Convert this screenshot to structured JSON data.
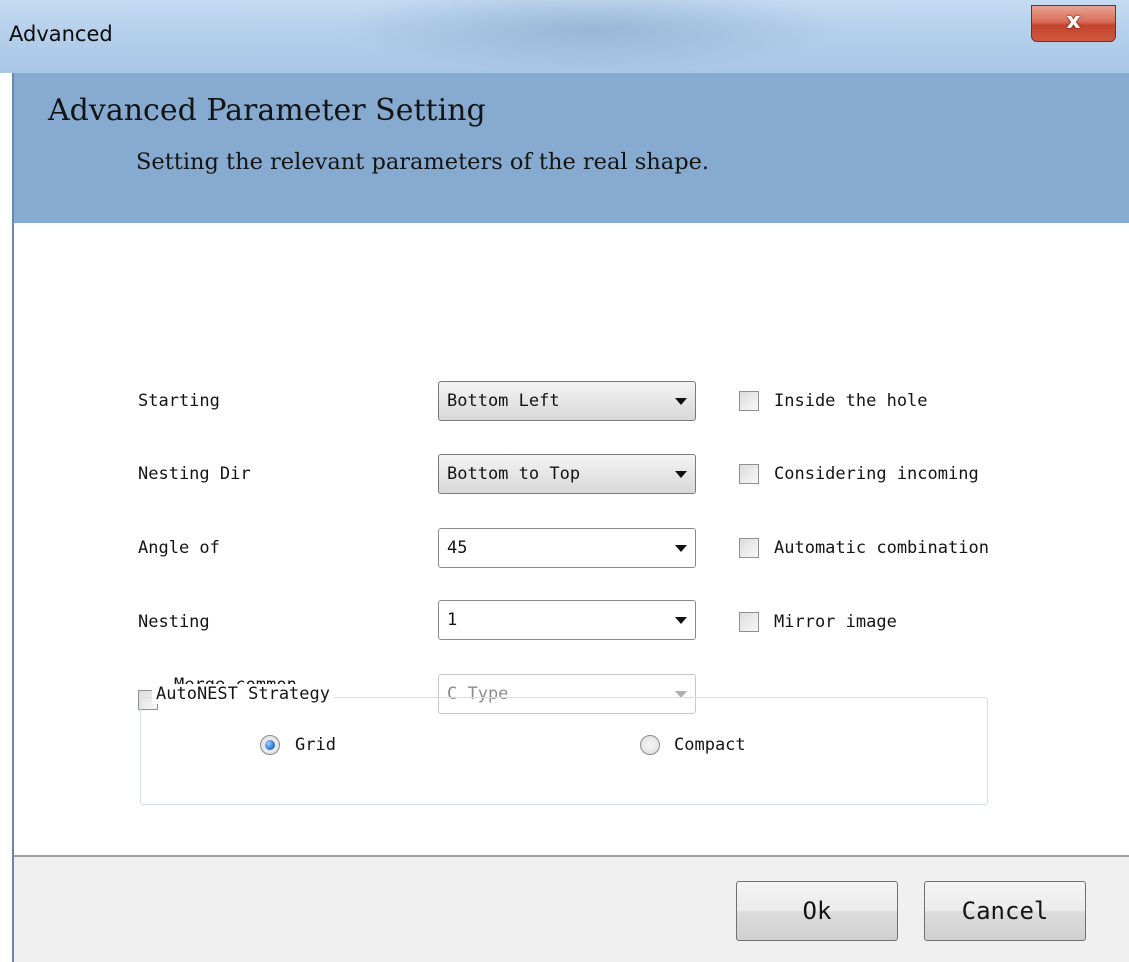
{
  "window": {
    "title": "Advanced",
    "close_glyph": "x"
  },
  "header": {
    "title": "Advanced Parameter Setting",
    "subtitle": "Setting the relevant parameters of the real shape."
  },
  "form": {
    "starting": {
      "label": "Starting",
      "value": "Bottom Left"
    },
    "nesting_dir": {
      "label": "Nesting Dir",
      "value": "Bottom to Top"
    },
    "angle_of": {
      "label": "Angle of",
      "value": "45"
    },
    "nesting": {
      "label": "Nesting",
      "value": "1"
    },
    "merge_common": {
      "label": "Merge common",
      "checked": false,
      "value": "C Type",
      "enabled": false
    },
    "options": {
      "inside_the_hole": {
        "label": "Inside the hole",
        "checked": false
      },
      "considering_incoming": {
        "label": "Considering incoming",
        "checked": false
      },
      "automatic_combination": {
        "label": "Automatic combination",
        "checked": false
      },
      "mirror_image": {
        "label": "Mirror image",
        "checked": false
      }
    }
  },
  "strategy": {
    "title": "AutoNEST Strategy",
    "grid_label": "Grid",
    "compact_label": "Compact",
    "selected": "Grid"
  },
  "buttons": {
    "ok": "Ok",
    "cancel": "Cancel"
  },
  "colors": {
    "header_band": "#87abd0",
    "close_button": "#c3432c",
    "radio_selected": "#2a7ad4"
  }
}
